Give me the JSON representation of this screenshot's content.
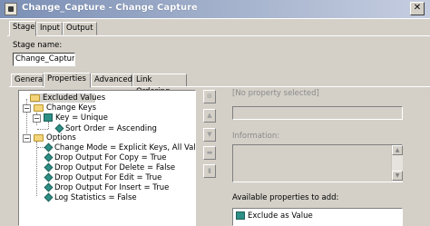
{
  "window": {
    "title": "Change_Capture - Change Capture"
  },
  "top_tabs": [
    "Stage",
    "Input",
    "Output"
  ],
  "stage_name": {
    "label": "Stage name:",
    "value": "Change_Capture"
  },
  "sub_tabs": [
    "General",
    "Properties",
    "Advanced",
    "Link Ordering"
  ],
  "tree": {
    "excluded_values": "Excluded Values",
    "change_keys": "Change Keys",
    "key": "Key = Unique",
    "sort_order": "Sort Order = Ascending",
    "options": "Options",
    "change_mode": "Change Mode = Explicit Keys, All Values",
    "drop_copy": "Drop Output For Copy = True",
    "drop_delete": "Drop Output For Delete = False",
    "drop_edit": "Drop Output For Edit = True",
    "drop_insert": "Drop Output For Insert = True",
    "log_stats": "Log Statistics = False",
    "expander_minus": "−"
  },
  "side_buttons": {
    "up": "▲",
    "down": "▼"
  },
  "right_panel": {
    "no_property": "[No property selected]",
    "information": "Information:",
    "available": "Available properties to add:",
    "available_items": [
      "Exclude as Value"
    ]
  },
  "titlebar_close": "✕"
}
